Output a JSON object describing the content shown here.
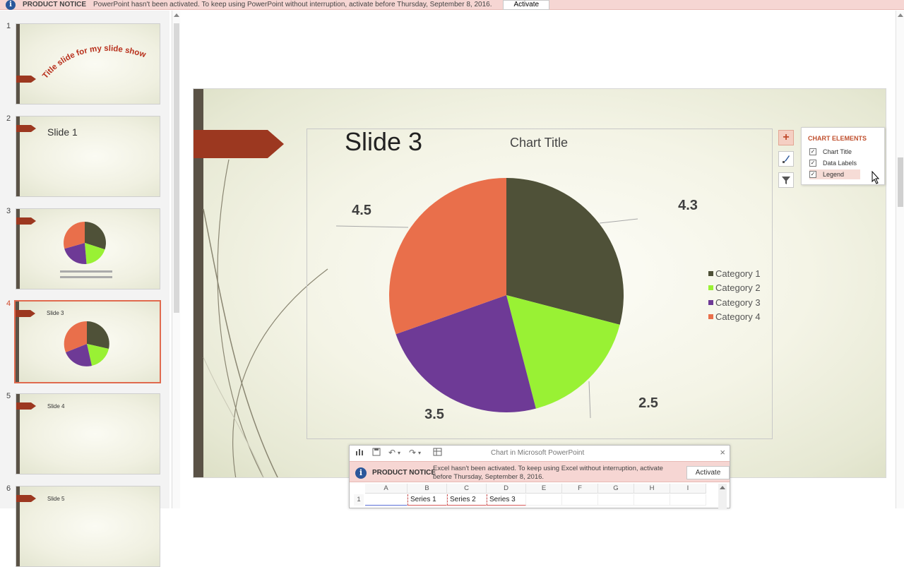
{
  "notice": {
    "label": "PRODUCT NOTICE",
    "message": "PowerPoint hasn't been activated. To keep using PowerPoint without interruption, activate before Thursday, September 8, 2016.",
    "button": "Activate"
  },
  "thumbnails": [
    {
      "num": "1",
      "text": "Title slide for my slide show"
    },
    {
      "num": "2",
      "text": "Slide 1"
    },
    {
      "num": "3",
      "text": ""
    },
    {
      "num": "4",
      "text": "Slide 3"
    },
    {
      "num": "5",
      "text": "Slide 4"
    },
    {
      "num": "6",
      "text": "Slide 5"
    }
  ],
  "slide": {
    "title": "Slide 3"
  },
  "chart_data": {
    "type": "pie",
    "title": "Chart Title",
    "categories": [
      "Category 1",
      "Category 2",
      "Category 3",
      "Category 4"
    ],
    "values": [
      4.3,
      2.5,
      3.5,
      4.5
    ],
    "value_labels": [
      "4.3",
      "2.5",
      "3.5",
      "4.5"
    ],
    "colors": [
      "#4f5138",
      "#99f134",
      "#6e3a96",
      "#e96f4b"
    ],
    "legend": "right"
  },
  "chart_elements": {
    "title": "CHART ELEMENTS",
    "items": [
      {
        "label": "Chart Title",
        "checked": true
      },
      {
        "label": "Data Labels",
        "checked": true
      },
      {
        "label": "Legend",
        "checked": true
      }
    ]
  },
  "excel": {
    "title": "Chart in Microsoft PowerPoint",
    "notice_label": "PRODUCT NOTICE",
    "notice_message": "Excel hasn't been activated. To keep using Excel without interruption, activate before Thursday, September 8, 2016.",
    "notice_button": "Activate",
    "columns": [
      "A",
      "B",
      "C",
      "D",
      "E",
      "F",
      "G",
      "H",
      "I"
    ],
    "rows": [
      "1"
    ],
    "row1": [
      "",
      "Series 1",
      "Series 2",
      "Series 3",
      "",
      "",
      "",
      "",
      ""
    ]
  }
}
